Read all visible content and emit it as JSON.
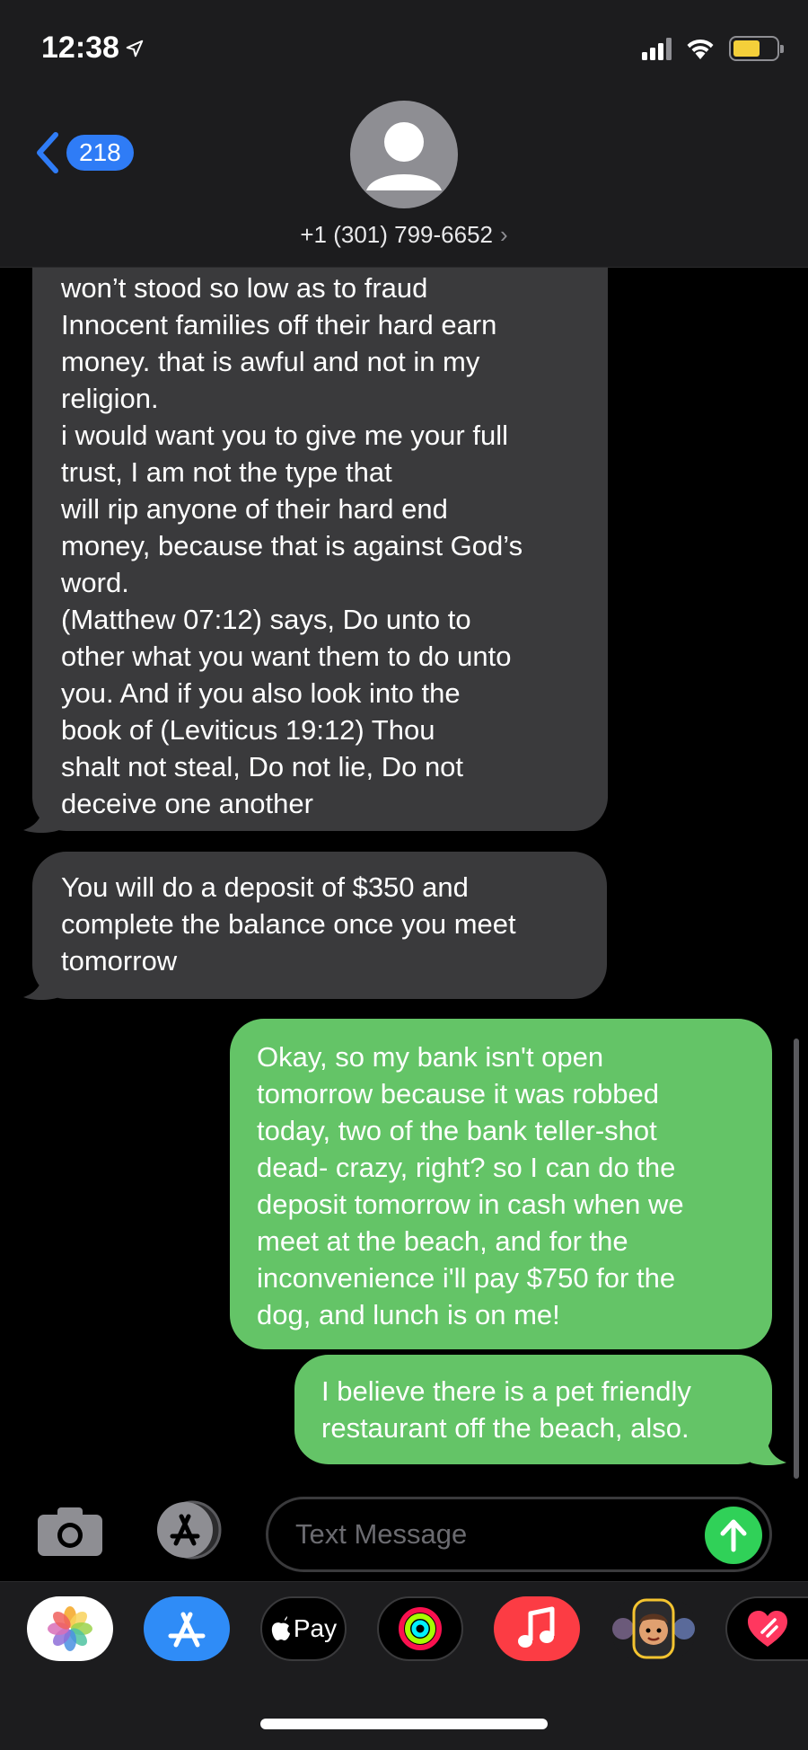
{
  "status_bar": {
    "time": "12:38"
  },
  "header": {
    "back_count": "218",
    "contact_number": "+1 (301) 799-6652",
    "chevron": "›"
  },
  "messages": [
    {
      "direction": "incoming",
      "lines": [
        "won’t stood so low as to fraud",
        "Innocent families off their hard earn",
        "money. that is awful and not in my",
        "religion.",
        "i would want you to give me your full",
        "trust, I am not the type that",
        "will rip anyone of their hard end",
        "money, because that is against God’s",
        "word.",
        "(Matthew 07:12) says, Do unto to",
        "other what you want them to do unto",
        "you. And if you also look into the",
        "book of (Leviticus 19:12) Thou",
        "shalt not steal, Do not lie, Do not",
        "deceive one another"
      ]
    },
    {
      "direction": "incoming",
      "lines": [
        "You will do a deposit of $350 and",
        "complete the balance once you meet",
        "tomorrow"
      ]
    },
    {
      "direction": "outgoing",
      "lines": [
        "Okay, so my bank isn't open",
        "tomorrow because it was robbed",
        "today, two of the bank teller-shot",
        "dead- crazy, right? so I can do the",
        "deposit tomorrow in cash when we",
        "meet at the beach, and for the",
        "inconvenience i'll pay $750 for the",
        "dog, and lunch is on me!"
      ]
    },
    {
      "direction": "outgoing",
      "lines": [
        "I believe there is a pet friendly",
        "restaurant off the beach, also."
      ]
    }
  ],
  "composer": {
    "placeholder": "Text Message"
  },
  "app_drawer": {
    "apps": [
      "photos-icon",
      "app-store-icon",
      "apple-pay-icon",
      "activity-icon",
      "music-icon",
      "memoji-icon",
      "digital-touch-icon"
    ],
    "apple_pay_label": "Pay"
  },
  "colors": {
    "incoming_bubble": "#3a3a3c",
    "outgoing_bubble": "#64c467",
    "accent": "#2f7cf6",
    "send_button": "#30d158"
  }
}
